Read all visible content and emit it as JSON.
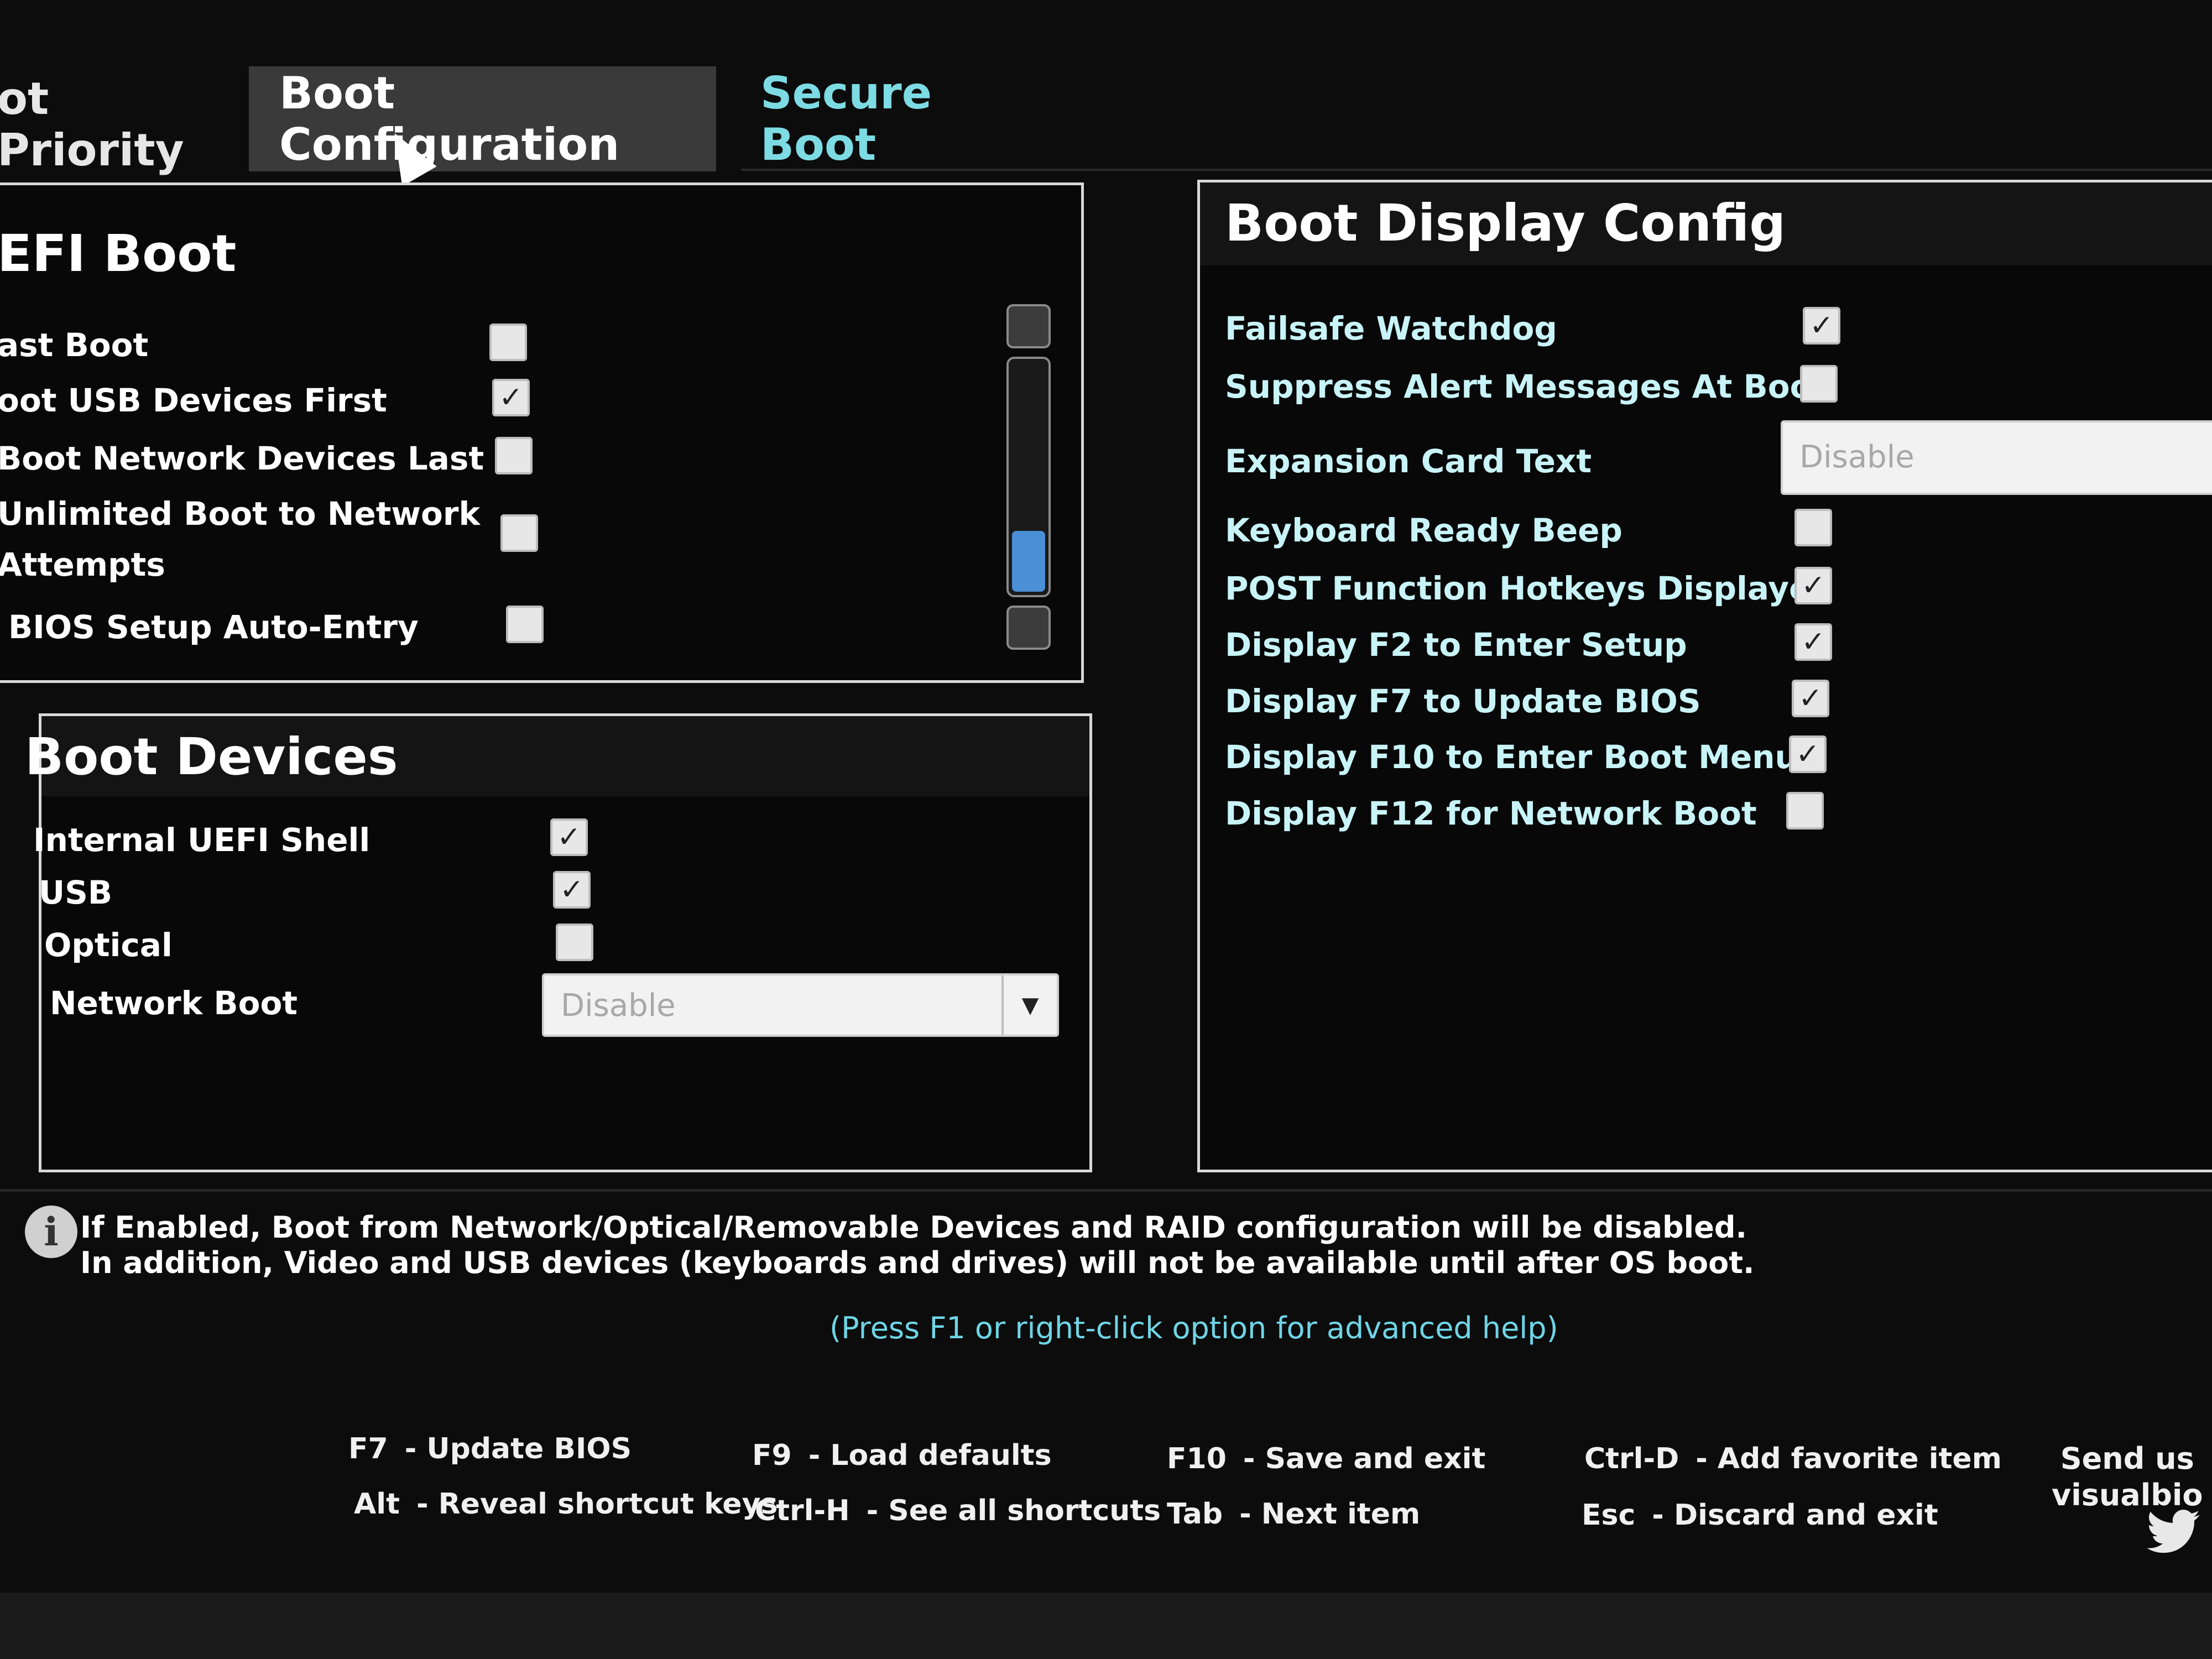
{
  "tabs": [
    {
      "label": "ot Priority"
    },
    {
      "label": "Boot Configuration"
    },
    {
      "label": "Secure Boot"
    }
  ],
  "efi_boot": {
    "title": "EFI Boot",
    "items": [
      {
        "label": "ast Boot",
        "checked": false,
        "mark": ""
      },
      {
        "label": "oot USB Devices First",
        "checked": true,
        "mark": "✓"
      },
      {
        "label": "Boot Network Devices Last",
        "checked": false,
        "mark": ""
      },
      {
        "label": "Unlimited Boot to Network",
        "label2": "Attempts",
        "checked": false,
        "mark": ""
      },
      {
        "label": "BIOS Setup Auto-Entry",
        "checked": false,
        "mark": ""
      }
    ]
  },
  "boot_devices": {
    "title": "Boot Devices",
    "items": [
      {
        "label": "Internal UEFI Shell",
        "checked": true,
        "mark": "✓"
      },
      {
        "label": "USB",
        "checked": true,
        "mark": "✓"
      },
      {
        "label": "Optical",
        "checked": false,
        "mark": ""
      }
    ],
    "network_boot": {
      "label": "Network Boot",
      "value": "Disable"
    }
  },
  "boot_display": {
    "title": "Boot Display Config",
    "items": [
      {
        "label": "Failsafe Watchdog",
        "checked": true,
        "mark": "✓"
      },
      {
        "label": "Suppress Alert Messages At Boot",
        "checked": false,
        "mark": ""
      },
      {
        "label": "Keyboard Ready Beep",
        "checked": false,
        "mark": ""
      },
      {
        "label": "POST Function Hotkeys Displayed",
        "checked": true,
        "mark": "✓"
      },
      {
        "label": "Display F2 to Enter Setup",
        "checked": true,
        "mark": "✓"
      },
      {
        "label": "Display F7 to Update BIOS",
        "checked": true,
        "mark": "✓"
      },
      {
        "label": "Display F10 to Enter Boot Menu",
        "checked": true,
        "mark": "✓"
      },
      {
        "label": "Display F12 for Network Boot",
        "checked": false,
        "mark": ""
      }
    ],
    "expansion_card_text": {
      "label": "Expansion Card Text",
      "value": "Disable"
    }
  },
  "info": {
    "icon": "i",
    "line1": "If Enabled, Boot from Network/Optical/Removable Devices and RAID configuration will be disabled.",
    "line2": "In addition, Video and USB devices (keyboards and drives) will not be available until after OS boot.",
    "help": "(Press F1 or right-click option for advanced help)"
  },
  "shortcuts": [
    {
      "key": "F7",
      "action": "- Update BIOS"
    },
    {
      "key": "Alt",
      "action": "- Reveal shortcut keys"
    },
    {
      "key": "F9",
      "action": "- Load defaults"
    },
    {
      "key": "Ctrl-H",
      "action": "- See all shortcuts"
    },
    {
      "key": "F10",
      "action": "- Save and exit"
    },
    {
      "key": "Tab",
      "action": "- Next item"
    },
    {
      "key": "Ctrl-D",
      "action": "- Add favorite item"
    },
    {
      "key": "Esc",
      "action": "- Discard and exit"
    }
  ],
  "send": {
    "line1": "Send us",
    "line2": "visualbio"
  },
  "colors": {
    "accent_cyan": "#7ddbe3",
    "scroll_thumb": "#4b8fd6",
    "background": "#0c0c0c"
  }
}
